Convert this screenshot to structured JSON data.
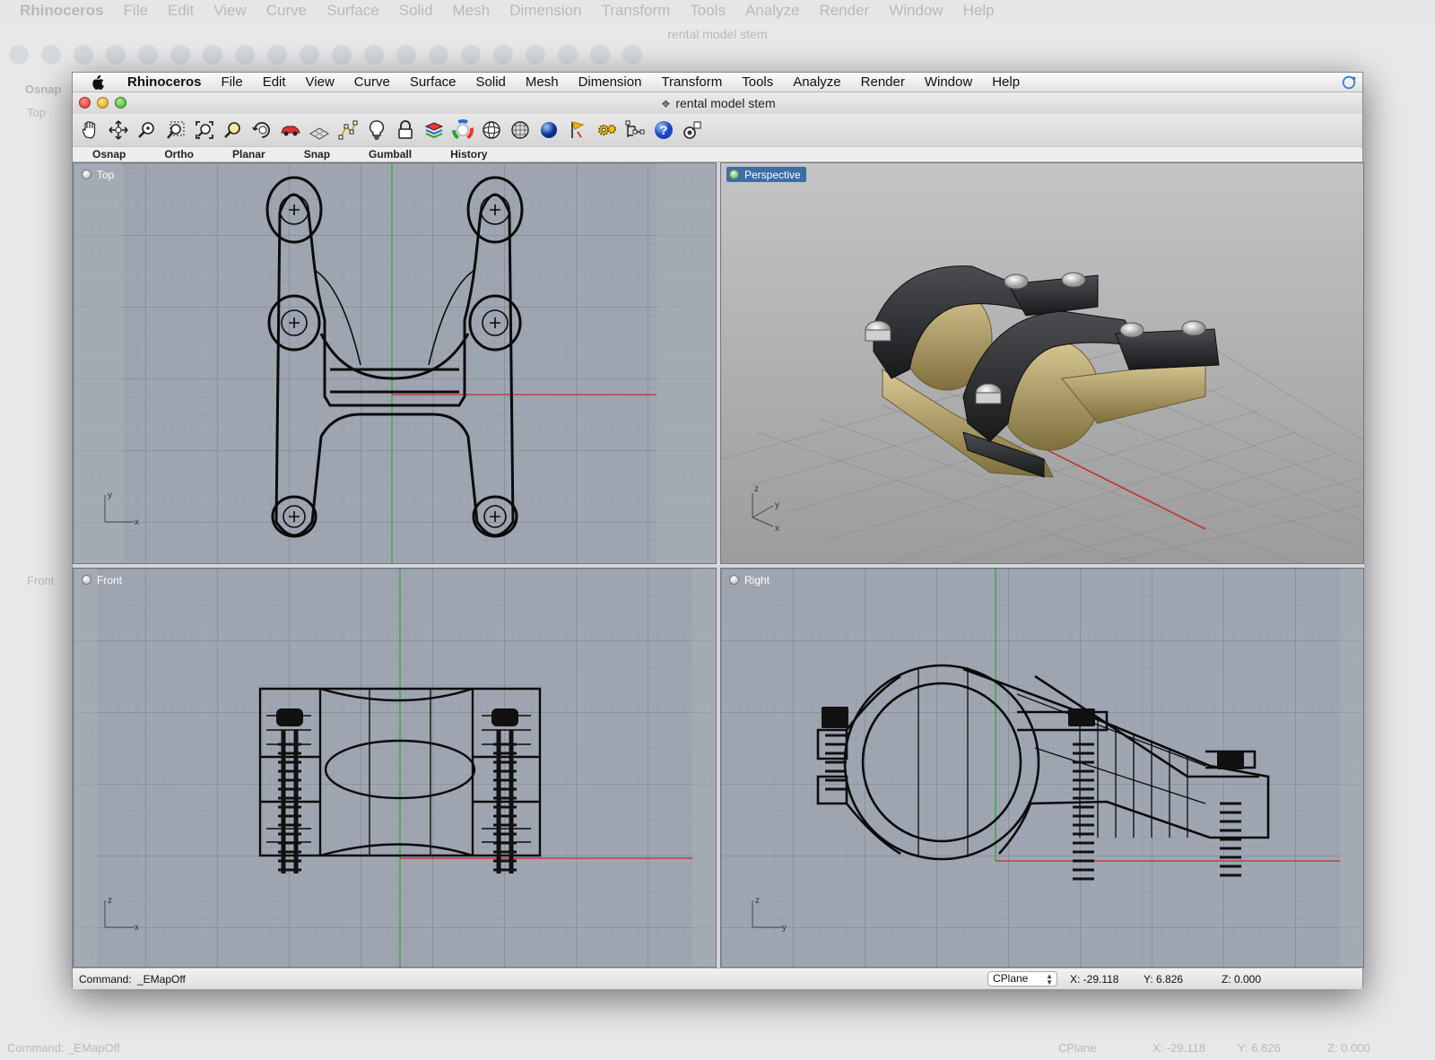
{
  "app": {
    "name": "Rhinoceros",
    "menus": [
      "File",
      "Edit",
      "View",
      "Curve",
      "Surface",
      "Solid",
      "Mesh",
      "Dimension",
      "Transform",
      "Tools",
      "Analyze",
      "Render",
      "Window",
      "Help"
    ],
    "window_title": "rental model stem"
  },
  "toolbar": {
    "icons": [
      "pan-icon",
      "move-icon",
      "zoom-window-icon",
      "zoom-dynamic-icon",
      "zoom-extents-icon",
      "zoom-selected-icon",
      "rotate-view-icon",
      "car-icon",
      "layer-grid-icon",
      "points-icon",
      "light-bulb-icon",
      "lock-icon",
      "layer-icon",
      "color-wheel-icon",
      "sphere-wire-icon",
      "mesh-sphere-icon",
      "render-sphere-icon",
      "flag-icon",
      "gear-icon",
      "tree-icon",
      "help-icon",
      "camera-icon"
    ]
  },
  "modes": [
    "Osnap",
    "Ortho",
    "Planar",
    "Snap",
    "Gumball",
    "History"
  ],
  "viewports": {
    "top": {
      "label": "Top",
      "axis_a": "y",
      "axis_b": "x"
    },
    "perspective": {
      "label": "Perspective",
      "axis_a": "z",
      "axis_b": "y",
      "axis_c": "x"
    },
    "front": {
      "label": "Front",
      "axis_a": "z",
      "axis_b": "x"
    },
    "right": {
      "label": "Right",
      "axis_a": "z",
      "axis_b": "y"
    }
  },
  "status": {
    "command_label": "Command:",
    "command_value": "_EMapOff",
    "cplane": "CPlane",
    "x": "X: -29.118",
    "y": "Y: 6.826",
    "z": "Z: 0.000"
  },
  "colors": {
    "x_axis": "#c62a2a",
    "y_axis": "#2aa62a",
    "active_viewport": "#3d6da6",
    "part_dark": "#2a2b2e",
    "part_gold": "#b3a16b"
  }
}
